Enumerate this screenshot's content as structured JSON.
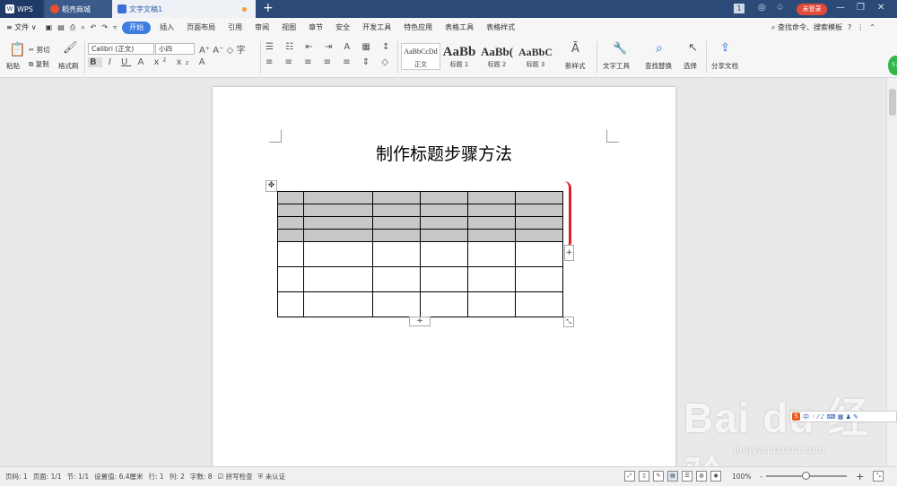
{
  "titlebar": {
    "tabs": [
      {
        "label": "WPS"
      },
      {
        "label": "稻壳商城"
      },
      {
        "label": "文字文稿1"
      }
    ],
    "new_tab": "+",
    "window_count": "1",
    "login_label": "未登录",
    "wps_logo_text": "W"
  },
  "menu": {
    "file": "≡ 文件 ∨",
    "items": [
      "开始",
      "插入",
      "页面布局",
      "引用",
      "审阅",
      "视图",
      "章节",
      "安全",
      "开发工具",
      "特色应用",
      "表格工具",
      "表格样式"
    ],
    "search": "查找命令、搜索模板",
    "help": "?",
    "more": "⋮"
  },
  "ribbon": {
    "paste": "粘贴",
    "cut": "剪切",
    "copy": "复制",
    "format_painter": "格式刷",
    "font_name": "Calibri (正文)",
    "font_size": "小四",
    "styles": [
      {
        "sample": "AaBbCcDd",
        "caption": "正文"
      },
      {
        "sample": "AaBb",
        "caption": "标题 1"
      },
      {
        "sample": "AaBb(",
        "caption": "标题 2"
      },
      {
        "sample": "AaBbC",
        "caption": "标题 3"
      }
    ],
    "new_style": "新样式",
    "text_tools": "文字工具",
    "find_replace": "查找替换",
    "select": "选择",
    "share": "分享文档"
  },
  "document": {
    "title": "制作标题步骤方法",
    "table": {
      "header_rows": 4,
      "body_rows": 3,
      "columns": 6
    },
    "add_symbol": "+",
    "move_symbol": "✥",
    "resize_symbol": "⤡"
  },
  "statusbar": {
    "items": [
      "页码: 1",
      "页面: 1/1",
      "节: 1/1",
      "设置值: 6.4厘米",
      "行: 1",
      "列: 2",
      "字数: 8",
      "拼写检查",
      "未认证"
    ],
    "zoom": "100%",
    "zoom_minus": "-",
    "zoom_plus": "+"
  },
  "badge": "57",
  "watermark": {
    "logo": "Bai du 经验",
    "url": "jingyan.baidu.com"
  },
  "ime": {
    "label": "中"
  },
  "colors": {
    "accent": "#3d7de0",
    "titlebar": "#2c4a78",
    "login": "#e04b3a",
    "mark": "#e02020"
  }
}
